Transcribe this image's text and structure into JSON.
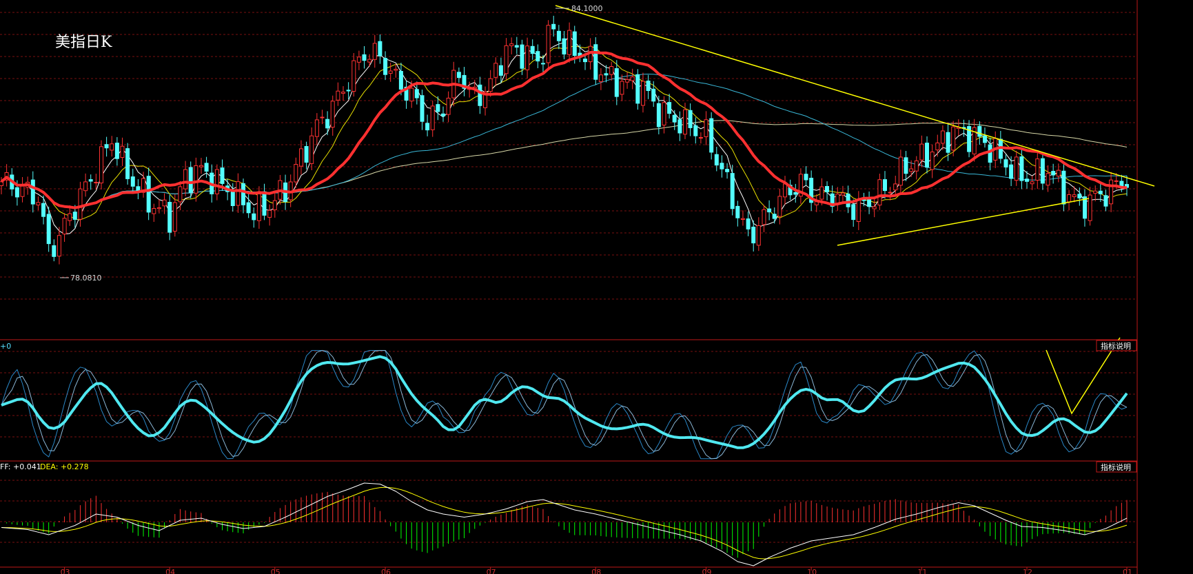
{
  "title": "美指日K",
  "panel_info": {
    "osc_prefix": "+0",
    "macd_diff_label": "FF: +0.041",
    "macd_dea_label": "DEA: +0.278"
  },
  "buttons": {
    "indicator_help_1": "指标说明",
    "indicator_help_2": "指标说明"
  },
  "colors": {
    "background": "#000000",
    "grid": "#7a1010",
    "up": "#ff3232",
    "down": "#54ffff",
    "ma_main": "#ff3030",
    "trendline": "#ffff00",
    "osc_main": "#50e8f0",
    "diff": "#ffffff",
    "dea": "#ffff00",
    "hist_pos": "#ff3030",
    "hist_neg": "#00ff00"
  },
  "chart_data": {
    "type": "candlestick",
    "annotations": {
      "high_label": "84.1000",
      "low_label": "78.0810"
    },
    "y_range": [
      76.9,
      84.5
    ],
    "x_ticks": [
      "03",
      "04",
      "05",
      "06",
      "07",
      "08",
      "09",
      "10",
      "11",
      "12",
      "01"
    ],
    "x_tick_index": [
      12,
      32,
      52,
      73,
      93,
      113,
      134,
      154,
      175,
      195,
      214
    ],
    "price_control": [
      [
        0,
        80.0
      ],
      [
        4,
        79.8
      ],
      [
        7,
        79.6
      ],
      [
        9,
        78.25
      ],
      [
        11,
        78.6
      ],
      [
        14,
        79.4
      ],
      [
        18,
        80.3
      ],
      [
        21,
        81.1
      ],
      [
        24,
        80.2
      ],
      [
        28,
        79.5
      ],
      [
        32,
        79.1
      ],
      [
        35,
        80.1
      ],
      [
        38,
        80.3
      ],
      [
        42,
        79.9
      ],
      [
        45,
        79.6
      ],
      [
        48,
        79.2
      ],
      [
        51,
        79.4
      ],
      [
        54,
        79.8
      ],
      [
        57,
        80.6
      ],
      [
        60,
        81.4
      ],
      [
        63,
        81.9
      ],
      [
        66,
        82.6
      ],
      [
        69,
        83.3
      ],
      [
        72,
        83.2
      ],
      [
        75,
        82.6
      ],
      [
        78,
        82.2
      ],
      [
        81,
        81.5
      ],
      [
        84,
        81.9
      ],
      [
        87,
        82.8
      ],
      [
        90,
        82.1
      ],
      [
        93,
        82.5
      ],
      [
        96,
        83.4
      ],
      [
        99,
        83.3
      ],
      [
        102,
        83.1
      ],
      [
        105,
        83.9
      ],
      [
        107,
        83.5
      ],
      [
        110,
        83.3
      ],
      [
        113,
        82.9
      ],
      [
        116,
        82.6
      ],
      [
        119,
        82.5
      ],
      [
        122,
        82.4
      ],
      [
        125,
        81.8
      ],
      [
        128,
        81.6
      ],
      [
        131,
        81.4
      ],
      [
        134,
        81.2
      ],
      [
        137,
        80.3
      ],
      [
        140,
        79.2
      ],
      [
        142,
        78.6
      ],
      [
        144,
        78.9
      ],
      [
        146,
        79.2
      ],
      [
        149,
        79.7
      ],
      [
        152,
        80.0
      ],
      [
        155,
        79.6
      ],
      [
        158,
        79.7
      ],
      [
        161,
        79.4
      ],
      [
        163,
        79.3
      ],
      [
        166,
        79.6
      ],
      [
        169,
        79.9
      ],
      [
        172,
        80.4
      ],
      [
        175,
        80.6
      ],
      [
        178,
        80.9
      ],
      [
        181,
        81.3
      ],
      [
        184,
        81.2
      ],
      [
        187,
        81.0
      ],
      [
        190,
        80.6
      ],
      [
        193,
        80.2
      ],
      [
        196,
        80.1
      ],
      [
        199,
        80.3
      ],
      [
        202,
        79.8
      ],
      [
        205,
        79.4
      ],
      [
        208,
        79.6
      ],
      [
        211,
        79.8
      ],
      [
        214,
        80.1
      ]
    ],
    "oscillator_control": [
      [
        0,
        50
      ],
      [
        3,
        60
      ],
      [
        6,
        35
      ],
      [
        9,
        25
      ],
      [
        12,
        45
      ],
      [
        16,
        70
      ],
      [
        18,
        72
      ],
      [
        21,
        50
      ],
      [
        25,
        25
      ],
      [
        28,
        20
      ],
      [
        31,
        40
      ],
      [
        34,
        58
      ],
      [
        37,
        50
      ],
      [
        40,
        35
      ],
      [
        44,
        20
      ],
      [
        48,
        15
      ],
      [
        52,
        40
      ],
      [
        56,
        78
      ],
      [
        60,
        90
      ],
      [
        63,
        86
      ],
      [
        66,
        88
      ],
      [
        69,
        92
      ],
      [
        72,
        95
      ],
      [
        75,
        70
      ],
      [
        78,
        50
      ],
      [
        81,
        40
      ],
      [
        84,
        22
      ],
      [
        87,
        40
      ],
      [
        90,
        60
      ],
      [
        93,
        48
      ],
      [
        96,
        65
      ],
      [
        99,
        68
      ],
      [
        102,
        55
      ],
      [
        105,
        58
      ],
      [
        108,
        42
      ],
      [
        111,
        35
      ],
      [
        114,
        28
      ],
      [
        118,
        30
      ],
      [
        121,
        35
      ],
      [
        124,
        25
      ],
      [
        127,
        20
      ],
      [
        130,
        22
      ],
      [
        133,
        18
      ],
      [
        136,
        15
      ],
      [
        140,
        10
      ],
      [
        144,
        25
      ],
      [
        148,
        55
      ],
      [
        152,
        68
      ],
      [
        155,
        52
      ],
      [
        158,
        58
      ],
      [
        161,
        40
      ],
      [
        164,
        50
      ],
      [
        167,
        70
      ],
      [
        170,
        75
      ],
      [
        173,
        72
      ],
      [
        176,
        80
      ],
      [
        179,
        85
      ],
      [
        182,
        90
      ],
      [
        185,
        78
      ],
      [
        188,
        55
      ],
      [
        191,
        30
      ],
      [
        194,
        20
      ],
      [
        197,
        28
      ],
      [
        200,
        42
      ],
      [
        203,
        30
      ],
      [
        206,
        22
      ],
      [
        210,
        45
      ],
      [
        214,
        70
      ]
    ],
    "macd_control": [
      [
        0,
        -0.05
      ],
      [
        5,
        -0.07
      ],
      [
        9,
        -0.12
      ],
      [
        14,
        -0.03
      ],
      [
        18,
        0.08
      ],
      [
        22,
        0.05
      ],
      [
        26,
        -0.03
      ],
      [
        30,
        -0.08
      ],
      [
        34,
        0.02
      ],
      [
        38,
        0.04
      ],
      [
        42,
        -0.02
      ],
      [
        46,
        -0.06
      ],
      [
        50,
        -0.04
      ],
      [
        54,
        0.05
      ],
      [
        58,
        0.15
      ],
      [
        62,
        0.25
      ],
      [
        66,
        0.32
      ],
      [
        69,
        0.38
      ],
      [
        72,
        0.37
      ],
      [
        75,
        0.3
      ],
      [
        78,
        0.2
      ],
      [
        81,
        0.12
      ],
      [
        84,
        0.08
      ],
      [
        88,
        0.05
      ],
      [
        92,
        0.08
      ],
      [
        96,
        0.13
      ],
      [
        100,
        0.2
      ],
      [
        103,
        0.22
      ],
      [
        106,
        0.17
      ],
      [
        109,
        0.12
      ],
      [
        113,
        0.08
      ],
      [
        117,
        0.03
      ],
      [
        121,
        -0.02
      ],
      [
        125,
        -0.07
      ],
      [
        129,
        -0.12
      ],
      [
        133,
        -0.18
      ],
      [
        137,
        -0.28
      ],
      [
        140,
        -0.38
      ],
      [
        143,
        -0.42
      ],
      [
        146,
        -0.34
      ],
      [
        150,
        -0.25
      ],
      [
        154,
        -0.18
      ],
      [
        158,
        -0.15
      ],
      [
        162,
        -0.12
      ],
      [
        166,
        -0.05
      ],
      [
        170,
        0.03
      ],
      [
        174,
        0.08
      ],
      [
        178,
        0.14
      ],
      [
        182,
        0.19
      ],
      [
        185,
        0.16
      ],
      [
        188,
        0.09
      ],
      [
        191,
        0.02
      ],
      [
        194,
        -0.04
      ],
      [
        198,
        -0.05
      ],
      [
        202,
        -0.08
      ],
      [
        206,
        -0.12
      ],
      [
        210,
        -0.06
      ],
      [
        214,
        0.04
      ]
    ]
  }
}
